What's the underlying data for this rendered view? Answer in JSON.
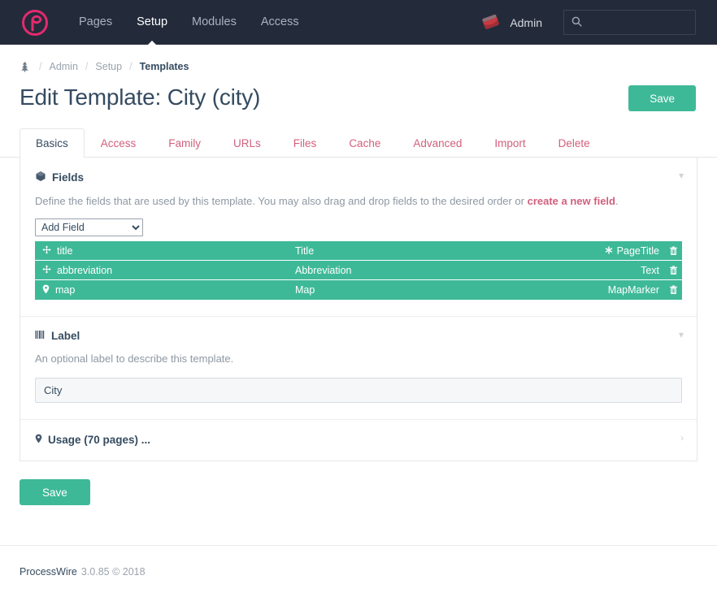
{
  "masthead": {
    "logo_icon": "processwire-logo-icon",
    "nav": [
      {
        "label": "Pages",
        "active": false
      },
      {
        "label": "Setup",
        "active": true
      },
      {
        "label": "Modules",
        "active": false
      },
      {
        "label": "Access",
        "active": false
      }
    ],
    "user": {
      "label": "Admin",
      "avatar_icon": "user-avatar-icon"
    },
    "search": {
      "placeholder": "",
      "value": "",
      "icon": "search-icon"
    }
  },
  "breadcrumb": {
    "home_icon": "page-tree-icon",
    "separator": "/",
    "items": [
      {
        "label": "Admin",
        "current": false
      },
      {
        "label": "Setup",
        "current": false
      },
      {
        "label": "Templates",
        "current": true
      }
    ]
  },
  "page": {
    "title": "Edit Template: City (city)",
    "save_top_label": "Save",
    "save_bottom_label": "Save"
  },
  "tabs": [
    {
      "label": "Basics",
      "active": true
    },
    {
      "label": "Access",
      "active": false
    },
    {
      "label": "Family",
      "active": false
    },
    {
      "label": "URLs",
      "active": false
    },
    {
      "label": "Files",
      "active": false
    },
    {
      "label": "Cache",
      "active": false
    },
    {
      "label": "Advanced",
      "active": false
    },
    {
      "label": "Import",
      "active": false
    },
    {
      "label": "Delete",
      "active": false
    }
  ],
  "fields_section": {
    "icon": "cube-icon",
    "title": "Fields",
    "toggle_icon": "chevron-down-icon",
    "description_before": "Define the fields that are used by this template. You may also drag and drop fields to the desired order or ",
    "description_link": "create a new field",
    "description_after": ".",
    "add_field_label": "Add Field",
    "rows": [
      {
        "handle_icon": "arrows-move-icon",
        "name": "title",
        "label": "Title",
        "type_icon": "asterisk-icon",
        "type": "PageTitle",
        "delete_icon": "trash-icon"
      },
      {
        "handle_icon": "arrows-move-icon",
        "name": "abbreviation",
        "label": "Abbreviation",
        "type_icon": "",
        "type": "Text",
        "delete_icon": "trash-icon"
      },
      {
        "handle_icon": "map-marker-icon",
        "name": "map",
        "label": "Map",
        "type_icon": "",
        "type": "MapMarker",
        "delete_icon": "trash-icon"
      }
    ]
  },
  "label_section": {
    "icon": "barcode-icon",
    "title": "Label",
    "toggle_icon": "chevron-down-icon",
    "description": "An optional label to describe this template.",
    "input_value": "City",
    "input_placeholder": ""
  },
  "usage_section": {
    "icon": "map-marker-icon",
    "title": "Usage (70 pages) ...",
    "toggle_icon": "chevron-right-icon"
  },
  "footer": {
    "brand": "ProcessWire",
    "version": "3.0.85 © 2018"
  },
  "colors": {
    "masthead_bg": "#232b3b",
    "accent_green": "#3eb998",
    "accent_pink": "#d25f7d",
    "logo_pink": "#e32a6d",
    "text_dark": "#354b60",
    "text_muted": "#8e98a3"
  }
}
